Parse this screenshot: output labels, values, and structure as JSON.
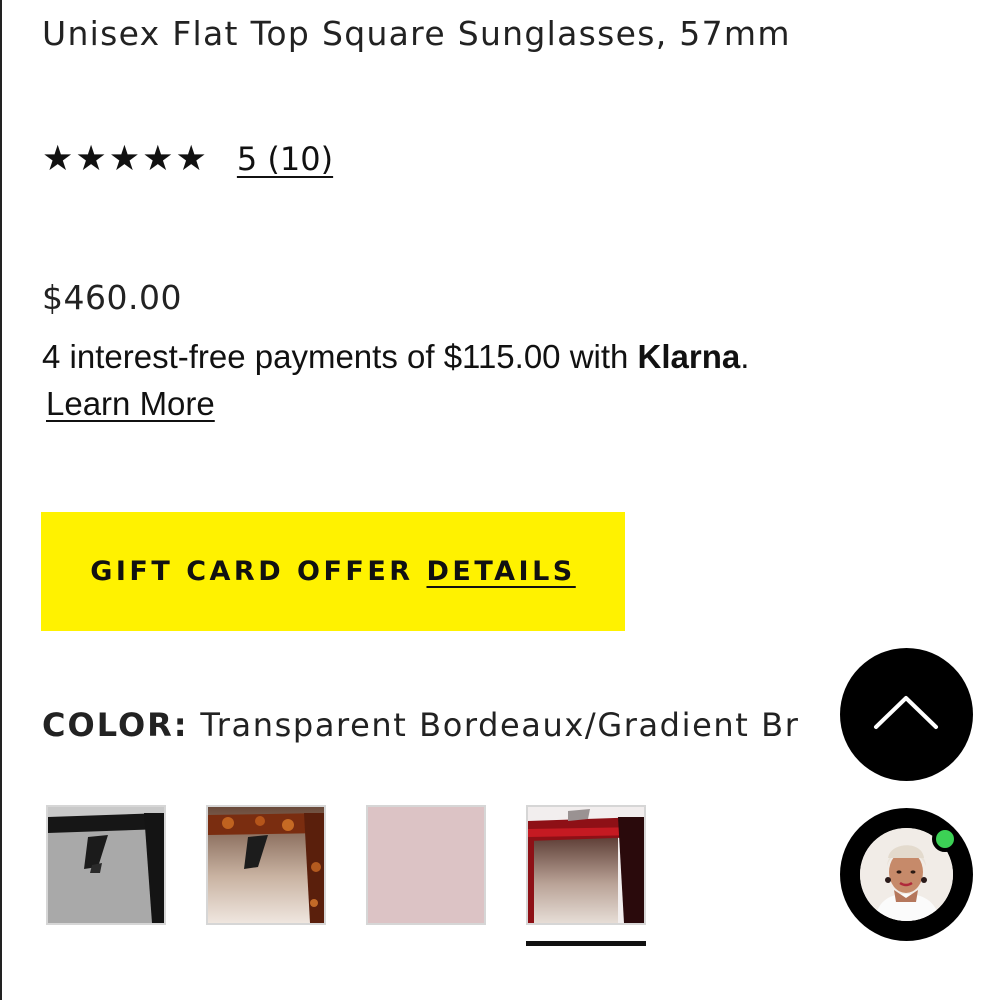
{
  "product": {
    "title": "Unisex Flat Top Square Sunglasses, 57mm",
    "rating": {
      "stars_display": "★★★★★",
      "stars_value": 5,
      "stars_max": 5,
      "link_text": "5 (10)"
    },
    "price": "$460.00",
    "klarna": {
      "prefix": "4 interest-free payments of $115.00 with ",
      "brand": "Klarna",
      "suffix": ".",
      "learn_more": "Learn More"
    },
    "gift_offer": {
      "text": "GIFT CARD OFFER ",
      "link": "DETAILS",
      "background": "#fff200"
    },
    "color": {
      "label": "COLOR:",
      "value": "Transparent Bordeaux/Gradient Br",
      "swatches": [
        {
          "name": "black-gray"
        },
        {
          "name": "tortoise-brown"
        },
        {
          "name": "pink"
        },
        {
          "name": "transparent-bordeaux-gradient",
          "selected": true
        }
      ]
    }
  },
  "floating": {
    "scroll_top_icon": "chevron-up-icon",
    "chat_icon": "agent-avatar",
    "online_status_color": "#3cd155"
  }
}
